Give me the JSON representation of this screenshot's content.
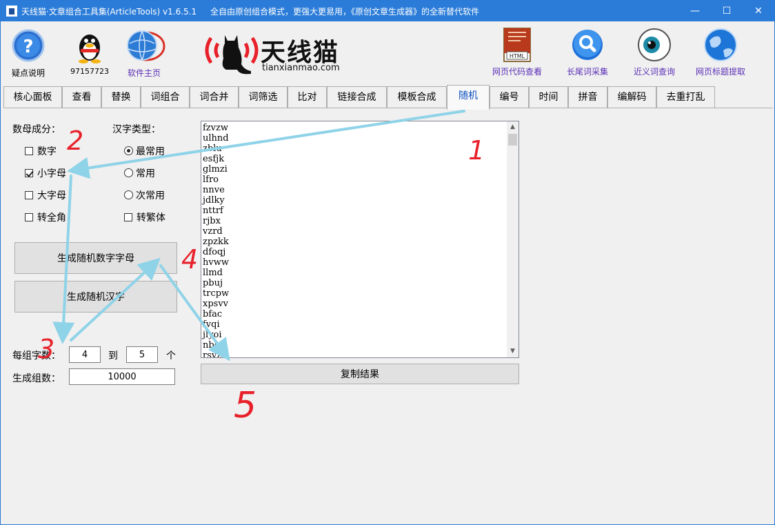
{
  "window": {
    "title": "天线猫·文章组合工具集(ArticleTools) v1.6.5.1",
    "subtitle": "全自由原创组合模式，更强大更易用，《原创文章生成器》的全新替代软件",
    "min": "—",
    "max": "☐",
    "close": "✕"
  },
  "toolbar": {
    "help": "疑点说明",
    "qq": "97157723",
    "home": "软件主页",
    "html_view": "网页代码查看",
    "longtail": "长尾词采集",
    "synonym": "近义词查询",
    "title_extract": "网页标题提取"
  },
  "logo": {
    "cn": "天线猫",
    "en": "tianxianmao.com"
  },
  "tabs": [
    "核心面板",
    "查看",
    "替换",
    "词组合",
    "词合并",
    "词筛选",
    "比对",
    "链接合成",
    "模板合成",
    "随机",
    "编号",
    "时间",
    "拼音",
    "编解码",
    "去重打乱"
  ],
  "active_tab": "随机",
  "random": {
    "char_comp_label": "数母成分：",
    "hanzi_type_label": "汉字类型：",
    "opt_digits": "数字",
    "opt_lower": "小字母",
    "opt_upper": "大字母",
    "opt_fullwidth": "转全角",
    "opt_most_common": "最常用",
    "opt_common": "常用",
    "opt_less_common": "次常用",
    "opt_traditional": "转繁体",
    "btn_gen_alnum": "生成随机数字字母",
    "btn_gen_hanzi": "生成随机汉字",
    "per_group_label": "每组字数：",
    "min_len": "4",
    "to": "到",
    "max_len": "5",
    "unit": "个",
    "group_count_label": "生成组数：",
    "group_count": "10000",
    "copy_button": "复制结果",
    "results": [
      "fzvzw",
      "ulhnd",
      "zblu",
      "esfjk",
      "glmzi",
      "lfro",
      "nnve",
      "jdlky",
      "nttrf",
      "rjbx",
      "vzrd",
      "zpzkk",
      "dfoqj",
      "hvww",
      "llmd",
      "pbuj",
      "trcpw",
      "xpsvv",
      "bfac",
      "fvqi",
      "jlyoi",
      "nbcy",
      "rsvz"
    ]
  },
  "annotations": {
    "n1": "1",
    "n2": "2",
    "n3": "3",
    "n4": "4",
    "n5": "5"
  },
  "colors": {
    "titlebar": "#2b7cd9",
    "arrow": "#8fd3e8",
    "mark": "#e8202a",
    "link": "#5b2fb6"
  }
}
